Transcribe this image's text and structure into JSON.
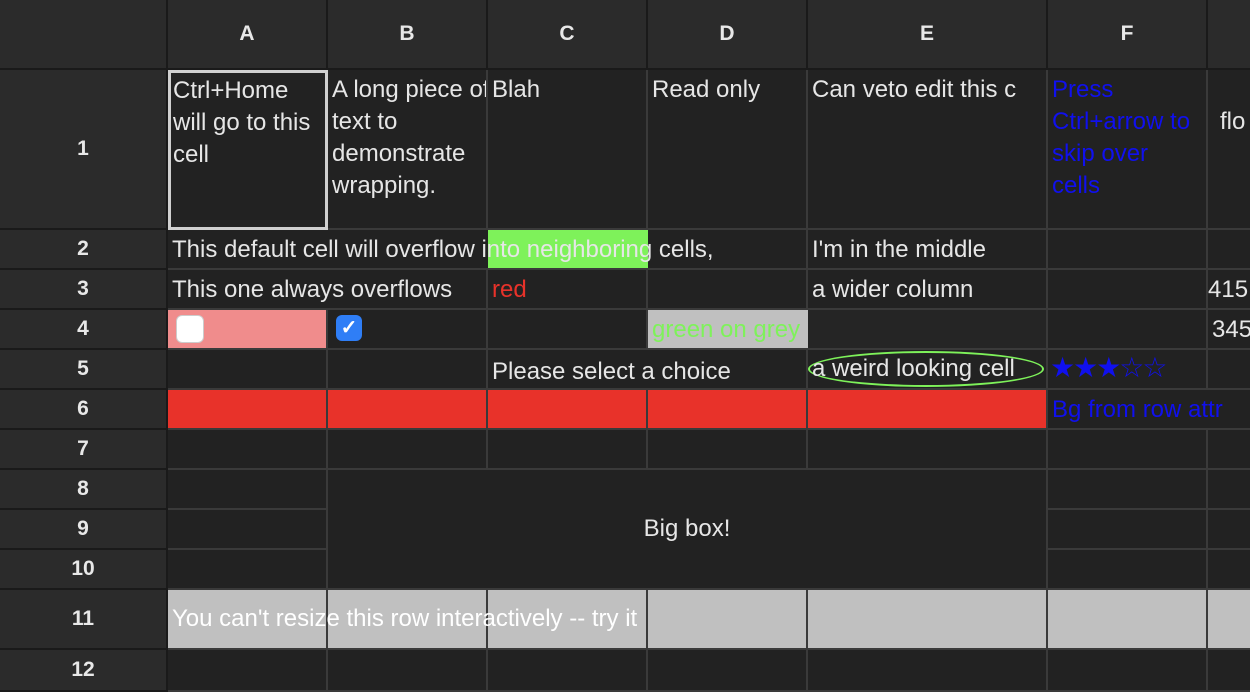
{
  "columns": [
    "A",
    "B",
    "C",
    "D",
    "E",
    "F"
  ],
  "rows": [
    "1",
    "2",
    "3",
    "4",
    "5",
    "6",
    "7",
    "8",
    "9",
    "10",
    "11",
    "12"
  ],
  "cells": {
    "a1": "Ctrl+Home will go to this cell",
    "b1": "A long piece of text to demonstrate wrapping.",
    "c1": "Blah",
    "d1": "Read only",
    "e1": "Can veto edit this c",
    "f1": "Press Ctrl+arrow to skip over cells",
    "g1": "flo",
    "a2": "This default cell will overflow into neighboring cells,",
    "e2": "I'm in the middle",
    "a3": "This one always overflows",
    "c3": "red",
    "e3": "a wider column",
    "g3": "415",
    "d4": "green on grey",
    "g4": "345",
    "c5": "Please select a choice",
    "e5": "a weird looking cell",
    "f5_stars": "★★★☆☆",
    "f6": "Bg from row attr",
    "merged_big": "Big box!",
    "a11": "You can't resize this row interactively -- try it"
  },
  "checkboxes": {
    "a4_checked": false,
    "b4_checked": true,
    "check_glyph": "✓"
  },
  "colors": {
    "pink": "#f08c8c",
    "green": "#7ef25a",
    "grey": "#c0c0c0",
    "red": "#e8322a",
    "blue": "#1010ee",
    "accent_blue": "#2f7ef6"
  }
}
